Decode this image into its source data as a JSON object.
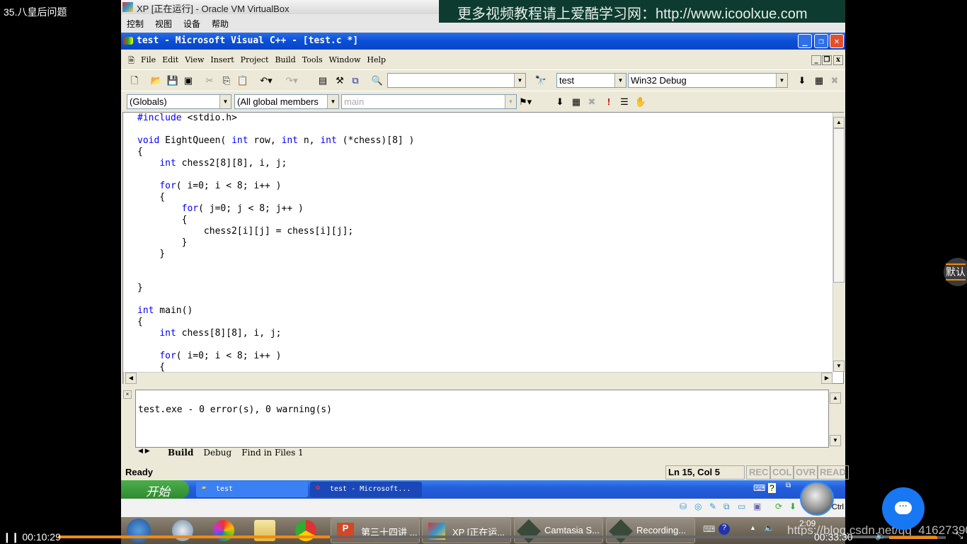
{
  "video": {
    "title": "35.八皇后问题",
    "current_time": "00:10:29",
    "total_time": "00:33:30",
    "progress_percent": 31,
    "volume_percent": 85,
    "watermark": "https://blog.csdn.net/qq_41627390",
    "quality_label": "默认"
  },
  "vbox": {
    "title": "XP [正在运行] - Oracle VM VirtualBox",
    "menu": [
      "控制",
      "视图",
      "设备",
      "帮助"
    ]
  },
  "banner": {
    "text": "更多视频教程请上爱酷学习网：http://www.icoolxue.com"
  },
  "vc": {
    "title": "test - Microsoft Visual C++ - [test.c *]",
    "menu": [
      "File",
      "Edit",
      "View",
      "Insert",
      "Project",
      "Build",
      "Tools",
      "Window",
      "Help"
    ],
    "toolbar": {
      "find_value": "",
      "project": "test",
      "config": "Win32 Debug"
    },
    "wizard": {
      "class": "(Globals)",
      "members": "(All global members",
      "function": "main"
    },
    "code": [
      [
        [
          "kw",
          "#include"
        ],
        [
          "t",
          " <stdio.h>"
        ]
      ],
      [],
      [
        [
          "kw",
          "void"
        ],
        [
          "t",
          " EightQueen( "
        ],
        [
          "kw",
          "int"
        ],
        [
          "t",
          " row, "
        ],
        [
          "kw",
          "int"
        ],
        [
          "t",
          " n, "
        ],
        [
          "kw",
          "int"
        ],
        [
          "t",
          " (*chess)[8] )"
        ]
      ],
      [
        [
          "t",
          "{"
        ]
      ],
      [
        [
          "t",
          "    "
        ],
        [
          "kw",
          "int"
        ],
        [
          "t",
          " chess2[8][8], i, j;"
        ]
      ],
      [],
      [
        [
          "t",
          "    "
        ],
        [
          "kw",
          "for"
        ],
        [
          "t",
          "( i=0; i < 8; i++ )"
        ]
      ],
      [
        [
          "t",
          "    {"
        ]
      ],
      [
        [
          "t",
          "        "
        ],
        [
          "kw",
          "for"
        ],
        [
          "t",
          "( j=0; j < 8; j++ )"
        ]
      ],
      [
        [
          "t",
          "        {"
        ]
      ],
      [
        [
          "t",
          "            chess2[i][j] = chess[i][j];"
        ]
      ],
      [
        [
          "t",
          "        }"
        ]
      ],
      [
        [
          "t",
          "    }"
        ]
      ],
      [],
      [],
      [
        [
          "t",
          "}"
        ]
      ],
      [],
      [
        [
          "kw",
          "int"
        ],
        [
          "t",
          " main()"
        ]
      ],
      [
        [
          "t",
          "{"
        ]
      ],
      [
        [
          "t",
          "    "
        ],
        [
          "kw",
          "int"
        ],
        [
          "t",
          " chess[8][8], i, j;"
        ]
      ],
      [],
      [
        [
          "t",
          "    "
        ],
        [
          "kw",
          "for"
        ],
        [
          "t",
          "( i=0; i < 8; i++ )"
        ]
      ],
      [
        [
          "t",
          "    {"
        ]
      ]
    ],
    "output": {
      "text": "test.exe - 0 error(s), 0 warning(s)",
      "tabs": [
        "Build",
        "Debug",
        "Find in Files 1"
      ],
      "active_tab": "Build"
    },
    "status": {
      "text": "Ready",
      "position": "Ln 15, Col 5",
      "indicators": [
        "REC",
        "COL",
        "OVR",
        "READ"
      ]
    }
  },
  "xp_taskbar": {
    "start": "开始",
    "buttons": [
      "test",
      "test - Microsoft..."
    ]
  },
  "vb_status": {
    "hostkey": "Right Ctrl"
  },
  "win7_taskbar": {
    "buttons": [
      "第三十四讲 ...",
      "XP [正在运...",
      "Camtasia S...",
      "Recording..."
    ],
    "clock": "2:09"
  }
}
